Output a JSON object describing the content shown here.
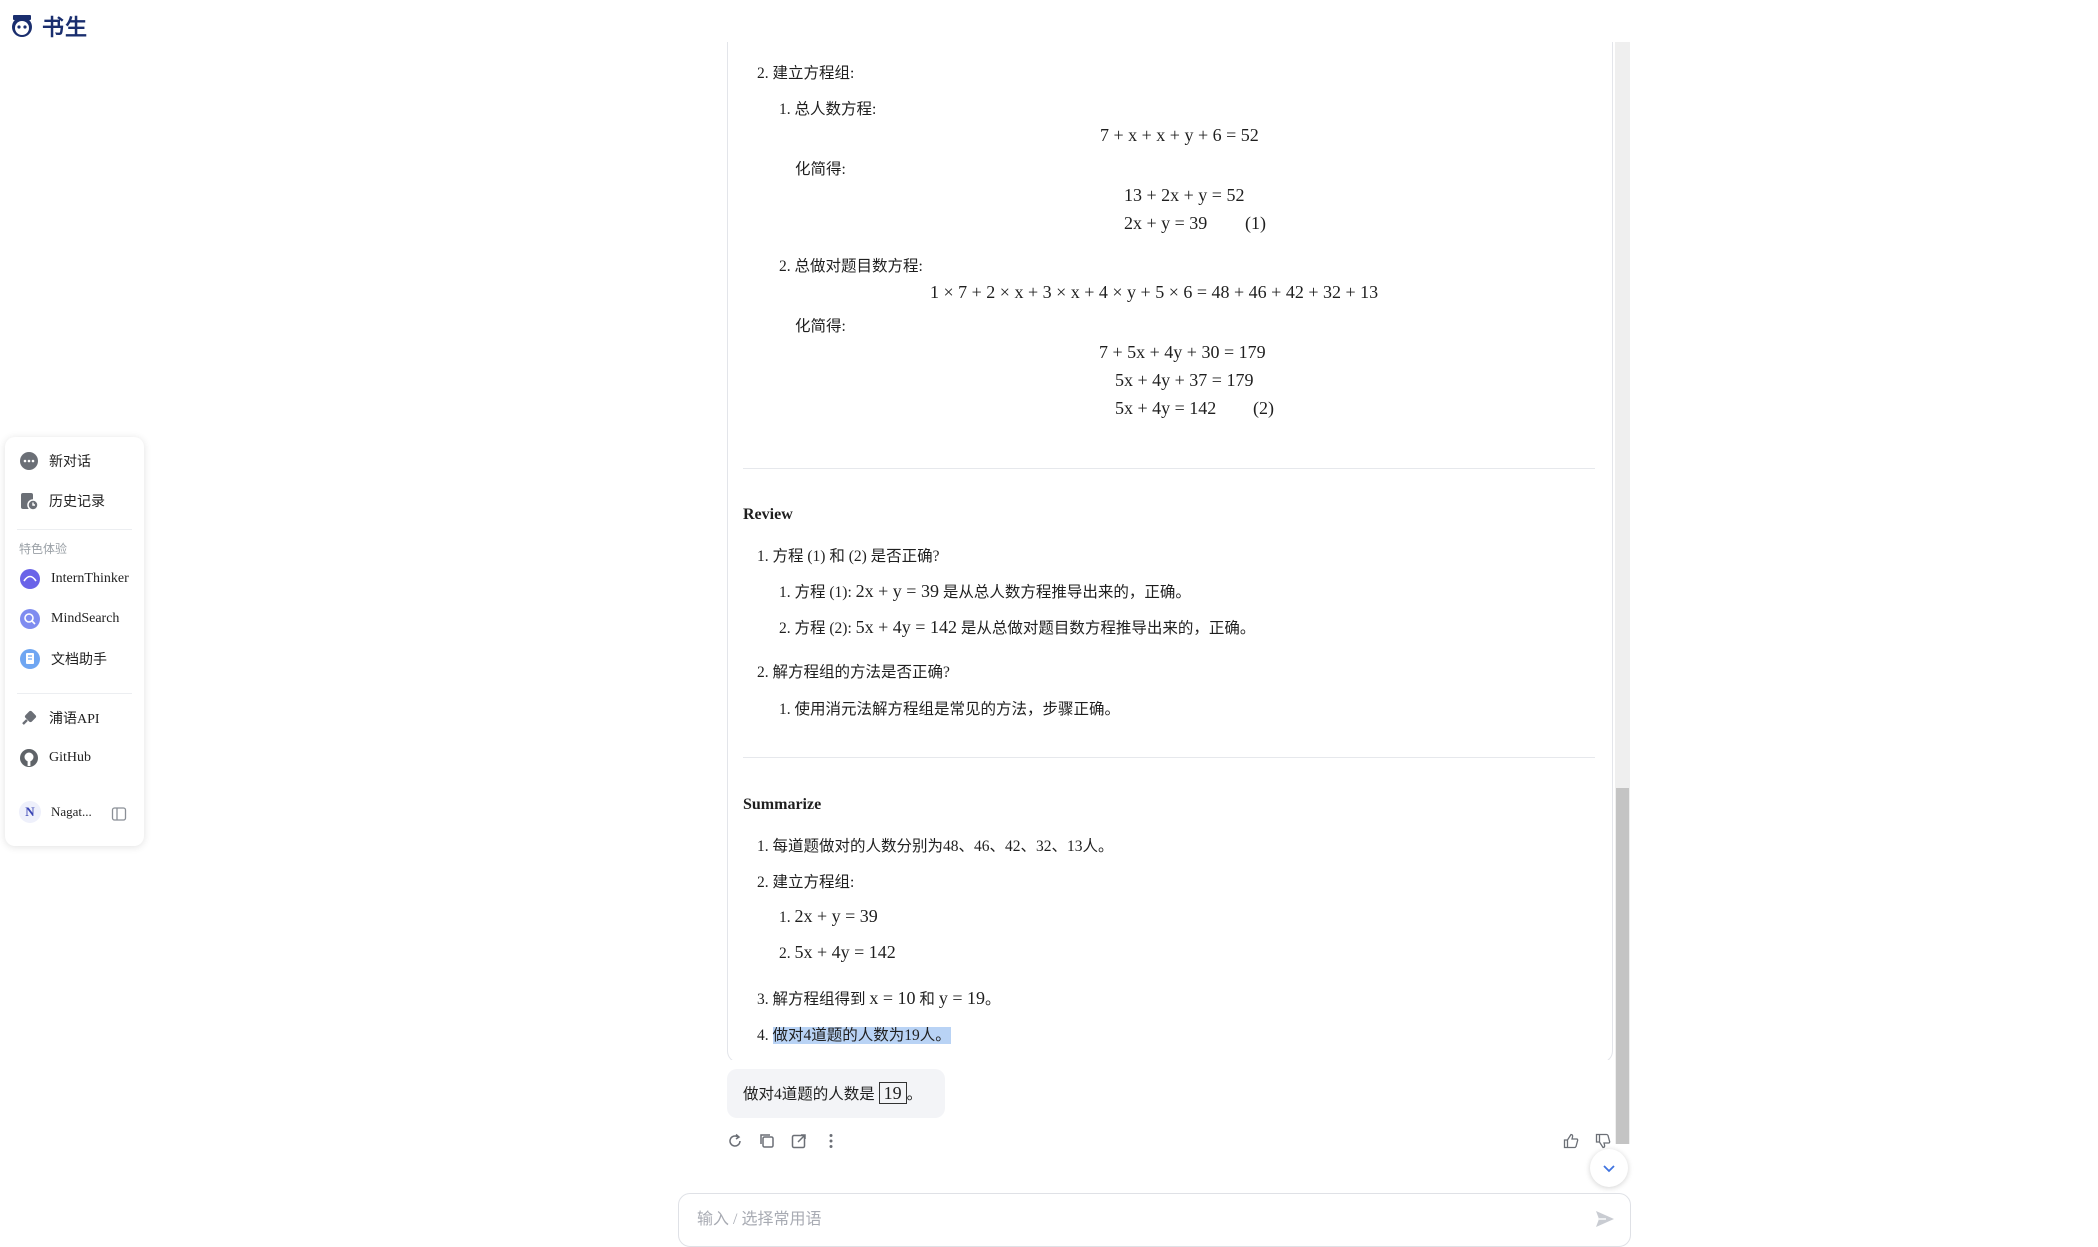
{
  "logo": {
    "text": "书生"
  },
  "sidebar": {
    "new_chat": "新对话",
    "history": "历史记录",
    "section_label": "特色体验",
    "features": [
      "InternThinker",
      "MindSearch",
      "文档助手"
    ],
    "links": [
      "浦语API",
      "GitHub"
    ],
    "user": {
      "avatar_letter": "N",
      "name": "Nagat..."
    }
  },
  "content": {
    "step2_title": "2. 建立方程组:",
    "eq1_title": "1. 总人数方程:",
    "eq1_main": "7 + x + x + y + 6 = 52",
    "simplify_label": "化简得:",
    "eq1_s1": "13 + 2x + y = 52",
    "eq1_s2": "2x + y = 39",
    "eq1_tag": "(1)",
    "eq2_title": "2. 总做对题目数方程:",
    "eq2_main": "1 × 7 + 2 × x + 3 × x + 4 × y + 5 × 6 = 48 + 46 + 42 + 32 + 13",
    "eq2_s1": "7 + 5x + 4y + 30 = 179",
    "eq2_s2": "5x + 4y + 37 = 179",
    "eq2_s3": "5x + 4y = 142",
    "eq2_tag": "(2)",
    "review_heading": "Review",
    "review_q1": "1. 方程 (1) 和 (2) 是否正确?",
    "review_q1_a1_prefix": "1. 方程 (1):",
    "review_q1_a1_math": "2x + y = 39",
    "review_q1_a1_suffix": "是从总人数方程推导出来的，正确。",
    "review_q1_a2_prefix": "2. 方程 (2):",
    "review_q1_a2_math": "5x + 4y = 142",
    "review_q1_a2_suffix": "是从总做对题目数方程推导出来的，正确。",
    "review_q2": "2. 解方程组的方法是否正确?",
    "review_q2_a1": "1. 使用消元法解方程组是常见的方法，步骤正确。",
    "summarize_heading": "Summarize",
    "sum1": "1. 每道题做对的人数分别为48、46、42、32、13人。",
    "sum2": "2. 建立方程组:",
    "sum2_a_num": "1.",
    "sum2_a": "2x + y = 39",
    "sum2_b_num": "2.",
    "sum2_b": "5x + 4y = 142",
    "sum3_prefix": "3. 解方程组得到",
    "sum3_x": "x = 10",
    "sum3_and": "和",
    "sum3_y": "y = 19",
    "sum3_end": "。",
    "sum4_num": "4.",
    "sum4_text": "做对4道题的人数为19人。"
  },
  "final_answer": {
    "prefix": "做对4道题的人数是",
    "value": "19",
    "suffix": "。"
  },
  "input": {
    "placeholder": "输入 / 选择常用语"
  },
  "colors": {
    "accent": "#5b6cf0",
    "selection": "#b9d3f5",
    "text": "#1f1f1f"
  }
}
